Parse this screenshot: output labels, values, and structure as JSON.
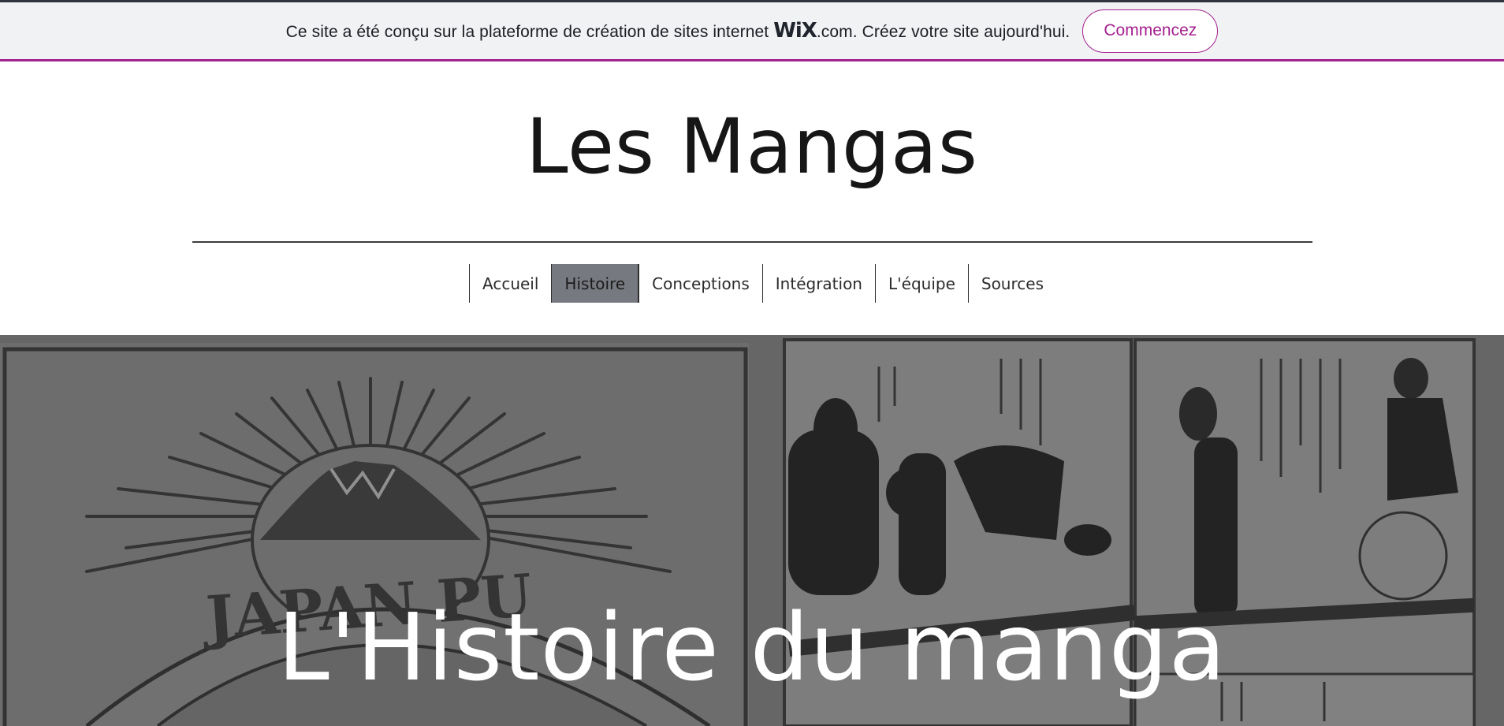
{
  "wix_banner": {
    "text_before": "Ce site a été conçu sur la plateforme de création de sites internet",
    "logo": "WiX",
    "text_after": ".com. Créez votre site aujourd'hui.",
    "cta_label": "Commencez",
    "accent_color": "#a4218f"
  },
  "header": {
    "site_title": "Les Mangas"
  },
  "nav": {
    "items": [
      {
        "label": "Accueil",
        "active": false
      },
      {
        "label": "Histoire",
        "active": true
      },
      {
        "label": "Conceptions",
        "active": false
      },
      {
        "label": "Intégration",
        "active": false
      },
      {
        "label": "L'équipe",
        "active": false
      },
      {
        "label": "Sources",
        "active": false
      }
    ]
  },
  "hero": {
    "title": "L'Histoire du manga",
    "background_image": "japan-punch-manga-illustration",
    "banner_word": "JAPAN PU"
  }
}
